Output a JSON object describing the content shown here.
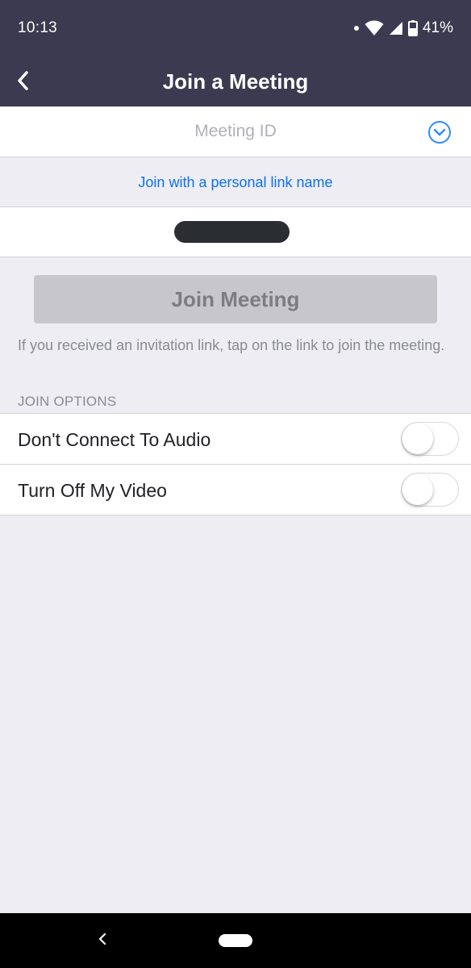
{
  "status_bar": {
    "time": "10:13",
    "battery": "41%",
    "icons": [
      "notification-dot-icon",
      "wifi-icon",
      "signal-icon",
      "battery-icon"
    ]
  },
  "nav_bar": {
    "title": "Join a Meeting",
    "back_icon": "chevron-left-icon"
  },
  "meeting_id": {
    "placeholder": "Meeting ID",
    "value": "",
    "dropdown_icon": "chevron-down-circle-icon"
  },
  "personal_link": {
    "label": "Join with a personal link name"
  },
  "name_field": {
    "value": ""
  },
  "join_button": {
    "label": "Join Meeting",
    "enabled": false
  },
  "hint": {
    "text": "If you received an invitation link, tap on the link to join the meeting."
  },
  "join_options": {
    "header": "JOIN OPTIONS",
    "items": [
      {
        "label": "Don't Connect To Audio",
        "on": false
      },
      {
        "label": "Turn Off My Video",
        "on": false
      }
    ]
  },
  "colors": {
    "header_bg": "#3b3a50",
    "accent": "#0e72ed",
    "page_bg": "#ededf3",
    "button_disabled": "#c6c6cb"
  }
}
